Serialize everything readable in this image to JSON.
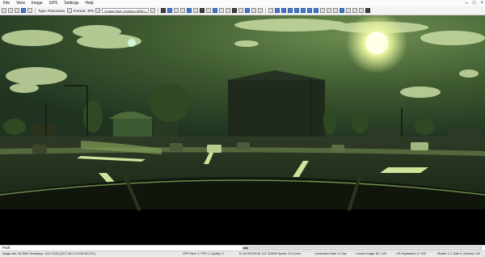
{
  "menu": {
    "items": [
      "File",
      "View",
      "Image",
      "GPS",
      "Settings",
      "Help"
    ]
  },
  "toolbar": {
    "type_label": "Type: Panoramic",
    "format_label": "Format: JPG",
    "output_size_label": "Output Size: Custom (4096 x"
  },
  "path": {
    "value": "Path:"
  },
  "status": {
    "image_info": "Image size: 50.2MB Timestamp: 110.2 5103 (2017-06-13 19:52:26 UTC)",
    "gps": "GPS Time: 0, PPS: 0, Quality: 0",
    "coords": "N: 44.057000 W: 121.315000 Speed: 23.0 km/h",
    "conversion": "Conversion Rate: 0.2 fps",
    "current_image": "Current Image: 80 / 100",
    "keyframes": "L/R Keyframes: 0 / 100",
    "shutter": "Shutter 1.0, Gain 0, Gamma 1.00"
  }
}
